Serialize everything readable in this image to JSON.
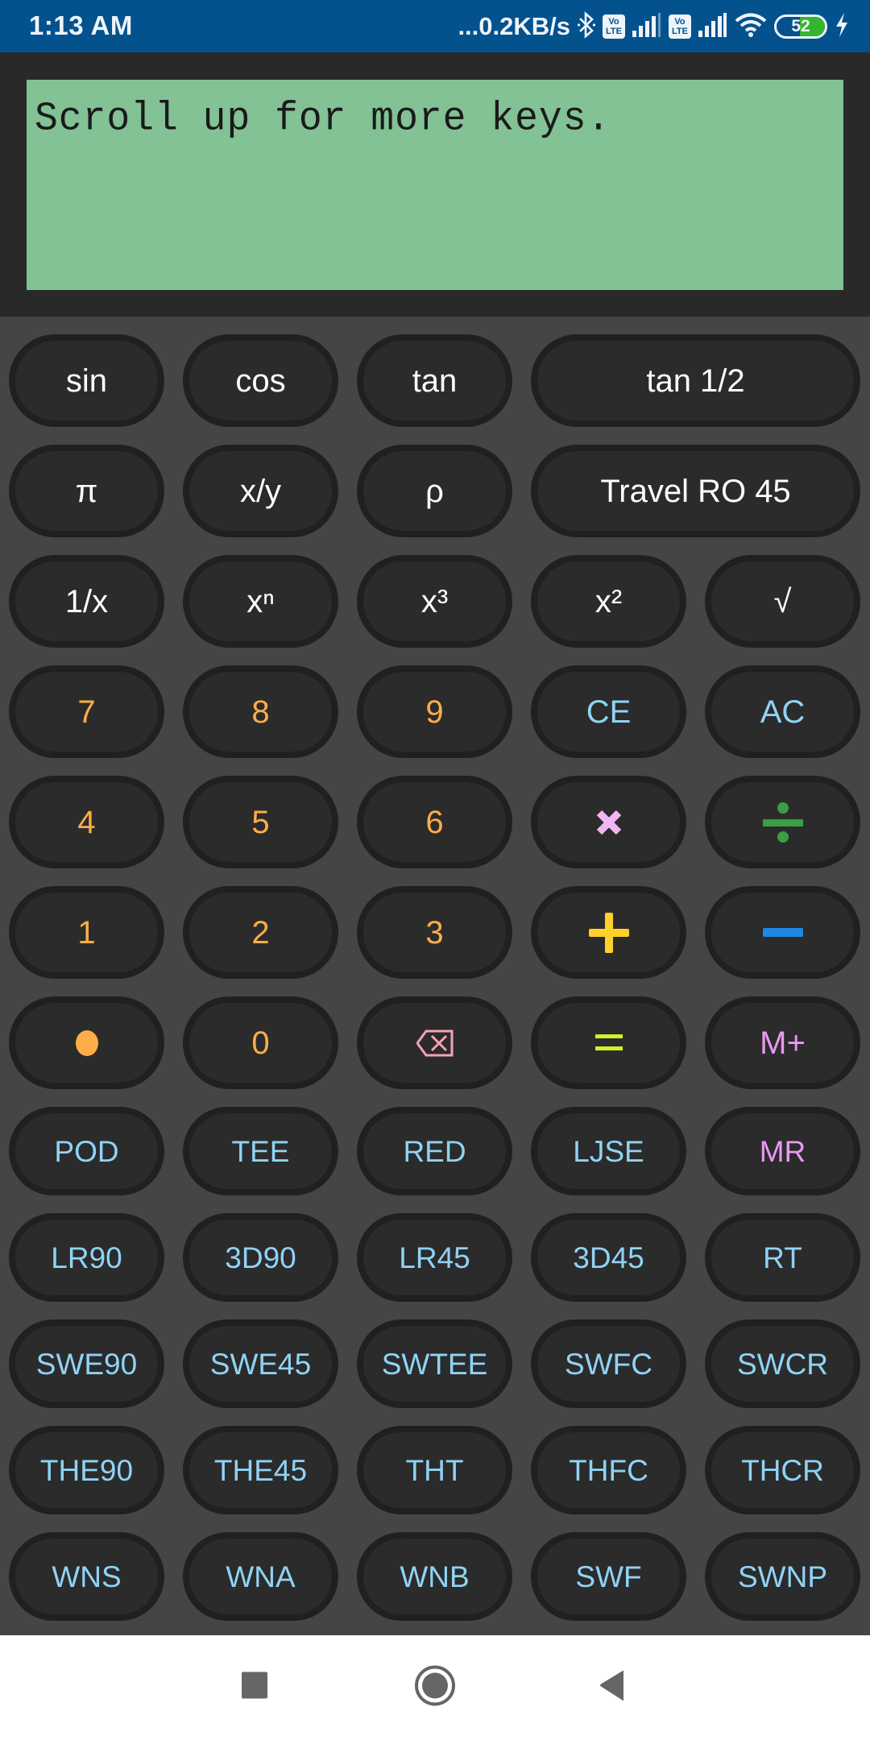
{
  "status_bar": {
    "time": "1:13 AM",
    "network_speed": "...0.2KB/s",
    "icons": [
      "bluetooth-icon",
      "volte-icon",
      "signal-icon",
      "volte-icon",
      "signal-icon",
      "wifi-icon",
      "battery-icon",
      "charging-icon"
    ],
    "volte_label": "Vo LTE",
    "battery_percent": 52,
    "battery_label": "52",
    "colors": {
      "background": "#03528e",
      "battery_fill": "#35b52d"
    }
  },
  "display": {
    "message": "Scroll up for more keys.",
    "colors": {
      "lcd": "#82c295",
      "frame": "#292929",
      "text": "#1a1a1a"
    }
  },
  "keypad": {
    "colors": {
      "background": "#454545",
      "key_fill": "#2b2b2b",
      "key_ring": "#202020",
      "function": "#ffffff",
      "digit": "#ffad48",
      "clear": "#8fd3f5",
      "code": "#8fd3f5",
      "memory": "#ea98f2",
      "backspace": "#f4a3b5",
      "equals": "#d2f02a",
      "plus": "#ffd12a",
      "minus": "#1e88e5",
      "divide": "#3a9e43",
      "multiply": "#f2b6f2"
    },
    "rows": [
      [
        {
          "label": "sin",
          "name": "sin-key",
          "kind": "function"
        },
        {
          "label": "cos",
          "name": "cos-key",
          "kind": "function"
        },
        {
          "label": "tan",
          "name": "tan-key",
          "kind": "function"
        },
        {
          "label": "tan 1/2",
          "name": "tan-half-key",
          "kind": "function",
          "wide": true
        }
      ],
      [
        {
          "label": "π",
          "name": "pi-key",
          "kind": "function"
        },
        {
          "label": "x/y",
          "name": "x-over-y-key",
          "kind": "function"
        },
        {
          "label": "ρ",
          "name": "rho-key",
          "kind": "function"
        },
        {
          "label": "Travel RO 45",
          "name": "travel-ro-45-key",
          "kind": "function",
          "wide": true
        }
      ],
      [
        {
          "label": "1/x",
          "name": "reciprocal-key",
          "kind": "function"
        },
        {
          "label": "xⁿ",
          "name": "power-n-key",
          "kind": "function"
        },
        {
          "label": "x³",
          "name": "cube-key",
          "kind": "function"
        },
        {
          "label": "x²",
          "name": "square-key",
          "kind": "function"
        },
        {
          "label": "√",
          "name": "square-root-key",
          "kind": "function"
        }
      ],
      [
        {
          "label": "7",
          "name": "digit-7-key",
          "kind": "digit"
        },
        {
          "label": "8",
          "name": "digit-8-key",
          "kind": "digit"
        },
        {
          "label": "9",
          "name": "digit-9-key",
          "kind": "digit"
        },
        {
          "label": "CE",
          "name": "clear-entry-key",
          "kind": "clear"
        },
        {
          "label": "AC",
          "name": "all-clear-key",
          "kind": "clear"
        }
      ],
      [
        {
          "label": "4",
          "name": "digit-4-key",
          "kind": "digit"
        },
        {
          "label": "5",
          "name": "digit-5-key",
          "kind": "digit"
        },
        {
          "label": "6",
          "name": "digit-6-key",
          "kind": "digit"
        },
        {
          "label": "",
          "name": "multiply-key",
          "kind": "multiply",
          "icon": "multiply-icon"
        },
        {
          "label": "",
          "name": "divide-key",
          "kind": "divide",
          "icon": "divide-icon"
        }
      ],
      [
        {
          "label": "1",
          "name": "digit-1-key",
          "kind": "digit"
        },
        {
          "label": "2",
          "name": "digit-2-key",
          "kind": "digit"
        },
        {
          "label": "3",
          "name": "digit-3-key",
          "kind": "digit"
        },
        {
          "label": "",
          "name": "plus-key",
          "kind": "plus",
          "icon": "plus-icon"
        },
        {
          "label": "",
          "name": "minus-key",
          "kind": "minus",
          "icon": "minus-icon"
        }
      ],
      [
        {
          "label": "",
          "name": "decimal-point-key",
          "kind": "digit",
          "icon": "dot-icon"
        },
        {
          "label": "0",
          "name": "digit-0-key",
          "kind": "digit"
        },
        {
          "label": "",
          "name": "backspace-key",
          "kind": "backspace",
          "icon": "backspace-icon"
        },
        {
          "label": "",
          "name": "equals-key",
          "kind": "equals",
          "icon": "equals-icon"
        },
        {
          "label": "M+",
          "name": "memory-add-key",
          "kind": "memory"
        }
      ],
      [
        {
          "label": "POD",
          "name": "pod-key",
          "kind": "code"
        },
        {
          "label": "TEE",
          "name": "tee-key",
          "kind": "code"
        },
        {
          "label": "RED",
          "name": "red-key",
          "kind": "code"
        },
        {
          "label": "LJSE",
          "name": "ljse-key",
          "kind": "code"
        },
        {
          "label": "MR",
          "name": "memory-recall-key",
          "kind": "memory"
        }
      ],
      [
        {
          "label": "LR90",
          "name": "lr90-key",
          "kind": "code"
        },
        {
          "label": "3D90",
          "name": "3d90-key",
          "kind": "code"
        },
        {
          "label": "LR45",
          "name": "lr45-key",
          "kind": "code"
        },
        {
          "label": "3D45",
          "name": "3d45-key",
          "kind": "code"
        },
        {
          "label": "RT",
          "name": "rt-key",
          "kind": "code"
        }
      ],
      [
        {
          "label": "SWE90",
          "name": "swe90-key",
          "kind": "code"
        },
        {
          "label": "SWE45",
          "name": "swe45-key",
          "kind": "code"
        },
        {
          "label": "SWTEE",
          "name": "swtee-key",
          "kind": "code"
        },
        {
          "label": "SWFC",
          "name": "swfc-key",
          "kind": "code"
        },
        {
          "label": "SWCR",
          "name": "swcr-key",
          "kind": "code"
        }
      ],
      [
        {
          "label": "THE90",
          "name": "the90-key",
          "kind": "code"
        },
        {
          "label": "THE45",
          "name": "the45-key",
          "kind": "code"
        },
        {
          "label": "THT",
          "name": "tht-key",
          "kind": "code"
        },
        {
          "label": "THFC",
          "name": "thfc-key",
          "kind": "code"
        },
        {
          "label": "THCR",
          "name": "thcr-key",
          "kind": "code"
        }
      ],
      [
        {
          "label": "WNS",
          "name": "wns-key",
          "kind": "code"
        },
        {
          "label": "WNA",
          "name": "wna-key",
          "kind": "code"
        },
        {
          "label": "WNB",
          "name": "wnb-key",
          "kind": "code"
        },
        {
          "label": "SWF",
          "name": "swf-key",
          "kind": "code"
        },
        {
          "label": "SWNP",
          "name": "swnp-key",
          "kind": "code"
        }
      ]
    ]
  },
  "nav_bar": {
    "buttons": [
      {
        "name": "recents-button",
        "icon": "square-icon"
      },
      {
        "name": "home-button",
        "icon": "circle-icon"
      },
      {
        "name": "back-button",
        "icon": "triangle-back-icon"
      }
    ],
    "icon_color": "#666666"
  }
}
